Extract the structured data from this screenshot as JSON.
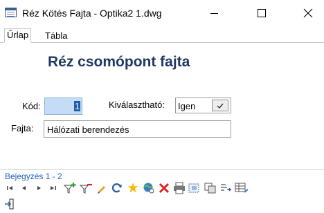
{
  "window": {
    "title": "Réz Kötés Fajta - Optika2 1.dwg",
    "minimize_symbol": "—",
    "maximize_symbol": "☐",
    "close_symbol": "✕"
  },
  "tabs": [
    {
      "label": "Űrlap",
      "active": true
    },
    {
      "label": "Tábla",
      "active": false
    }
  ],
  "form": {
    "heading": "Réz csomópont fajta",
    "kod_label": "Kód:",
    "kod_value": "1",
    "kivalaszthato_label": "Kiválasztható:",
    "kivalaszthato_value": "Igen",
    "fajta_label": "Fajta:",
    "fajta_value": "Hálózati berendezés"
  },
  "records": {
    "text": "Bejegyzés 1 - 2"
  },
  "toolbar": {
    "icons": [
      "first-record-icon",
      "previous-record-icon",
      "next-record-icon",
      "last-record-icon",
      "filter-add-icon",
      "filter-remove-icon",
      "edit-pencil-icon",
      "refresh-icon",
      "new-record-star-icon",
      "zoom-globe-icon",
      "delete-icon",
      "print-icon",
      "select-icon",
      "copy-icon",
      "export-icon",
      "table-view-icon"
    ],
    "exit_icon": "exit-icon"
  },
  "colors": {
    "heading": "#1f3864",
    "record_text": "#1f5fbf",
    "code_field_bg": "#c4dcf6",
    "selection_bg": "#1f5ea8"
  }
}
